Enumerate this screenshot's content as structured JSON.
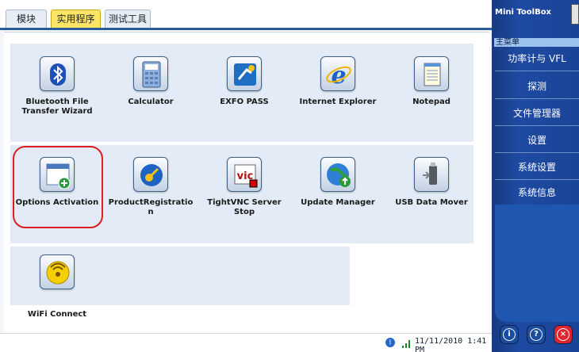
{
  "tabs": [
    {
      "label": "模块"
    },
    {
      "label": "实用程序"
    },
    {
      "label": "测试工具"
    }
  ],
  "apps": [
    {
      "label": "Bluetooth File\nTransfer Wizard",
      "icon": "bluetooth-icon"
    },
    {
      "label": "Calculator",
      "icon": "calculator-icon"
    },
    {
      "label": "EXFO PASS",
      "icon": "exfo-pass-icon"
    },
    {
      "label": "Internet Explorer",
      "icon": "internet-explorer-icon"
    },
    {
      "label": "Notepad",
      "icon": "notepad-icon"
    },
    {
      "label": "Options Activation",
      "icon": "options-activation-icon"
    },
    {
      "label": "ProductRegistratio\nn",
      "icon": "product-registration-icon"
    },
    {
      "label": "TightVNC Server\nStop",
      "icon": "tightvnc-icon"
    },
    {
      "label": "Update Manager",
      "icon": "update-manager-icon"
    },
    {
      "label": "USB Data Mover",
      "icon": "usb-data-mover-icon"
    },
    {
      "label": "WiFi Connect",
      "icon": "wifi-icon"
    }
  ],
  "side": {
    "title": "Mini ToolBox",
    "section": "主菜单",
    "menu": [
      {
        "label": "功率计与 VFL"
      },
      {
        "label": "探测"
      },
      {
        "label": "文件管理器"
      },
      {
        "label": "设置"
      },
      {
        "label": "系统设置"
      },
      {
        "label": "系统信息"
      }
    ]
  },
  "status": {
    "datetime": "11/11/2010 1:41 PM"
  },
  "colors": {
    "active_tab": "#ffe566",
    "side_panel": "#1e4aa2",
    "highlight": "#dc1d24"
  }
}
